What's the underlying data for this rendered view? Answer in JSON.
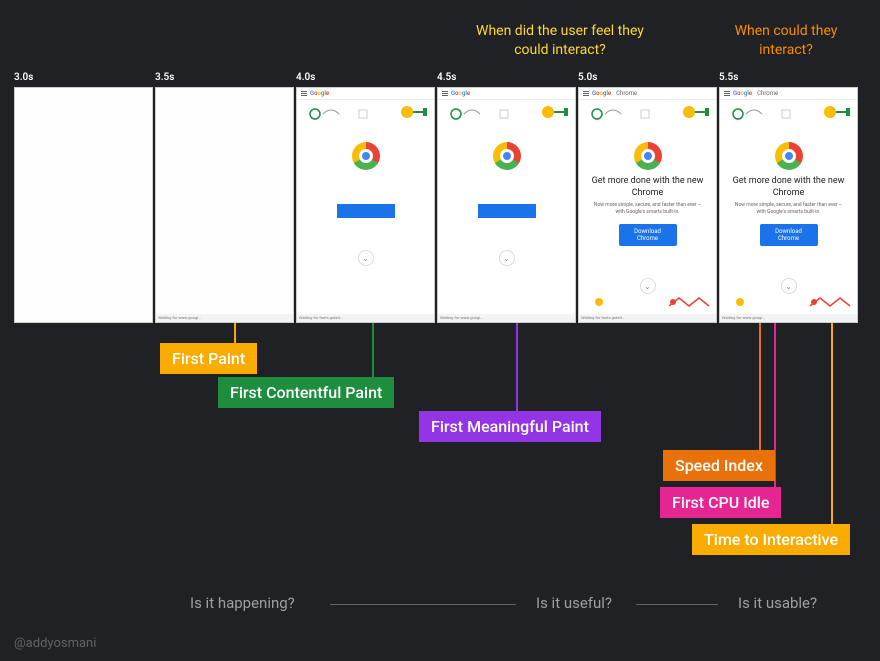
{
  "top_questions": {
    "q1": "When did the user feel they could interact?",
    "q2": "When could they interact?"
  },
  "times": [
    "3.0s",
    "3.5s",
    "4.0s",
    "4.5s",
    "5.0s",
    "5.5s"
  ],
  "page": {
    "brand": "Google",
    "product": "Chrome",
    "headline": "Get more done with the new Chrome",
    "subline": "Now more simple, secure, and faster than ever – with Google's smarts built-in.",
    "cta": "Download Chrome",
    "status_waiting": "Waiting for www.googl…",
    "status_fonts": "Waiting for fonts.gstati…"
  },
  "metrics": {
    "fp": "First Paint",
    "fcp": "First Contentful Paint",
    "fmp": "First Meaningful Paint",
    "si": "Speed Index",
    "fci": "First CPU Idle",
    "tti": "Time to Interactive"
  },
  "bottom": {
    "q1": "Is it happening?",
    "q2": "Is it useful?",
    "q3": "Is it usable?"
  },
  "credit": "@addyosmani",
  "colors": {
    "fp": "#f9ab00",
    "fcp": "#1e8e3e",
    "fmp": "#9334e6",
    "si": "#e8710a",
    "fci": "#e52592",
    "tti": "#f9ab00"
  }
}
